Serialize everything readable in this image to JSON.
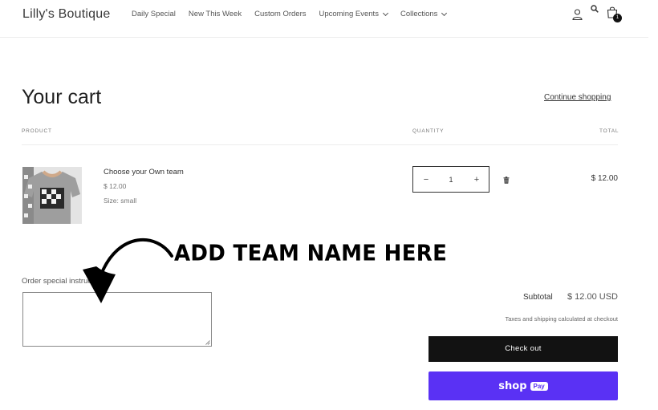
{
  "header": {
    "logo": "Lilly's Boutique",
    "nav": [
      {
        "label": "Daily Special"
      },
      {
        "label": "New This Week"
      },
      {
        "label": "Custom Orders"
      },
      {
        "label": "Upcoming Events"
      },
      {
        "label": "Collections"
      }
    ],
    "cart_count": "1"
  },
  "cart": {
    "title": "Your cart",
    "continue_label": "Continue shopping",
    "columns": {
      "product": "PRODUCT",
      "quantity": "QUANTITY",
      "total": "TOTAL"
    },
    "item": {
      "name": "Choose your Own team",
      "price": "$ 12.00",
      "size": "Size: small",
      "quantity": "1",
      "line_total": "$ 12.00"
    }
  },
  "annotation": {
    "text": "ADD TEAM NAME HERE"
  },
  "note": {
    "label": "Order special instructions"
  },
  "summary": {
    "subtotal_label": "Subtotal",
    "subtotal_value": "$ 12.00 USD",
    "taxes_note": "Taxes and shipping calculated at checkout",
    "checkout_label": "Check out",
    "shoppay_shop": "shop",
    "shoppay_pay": "Pay"
  },
  "colors": {
    "shoppay": "#5a31f4",
    "checkout": "#121212"
  }
}
